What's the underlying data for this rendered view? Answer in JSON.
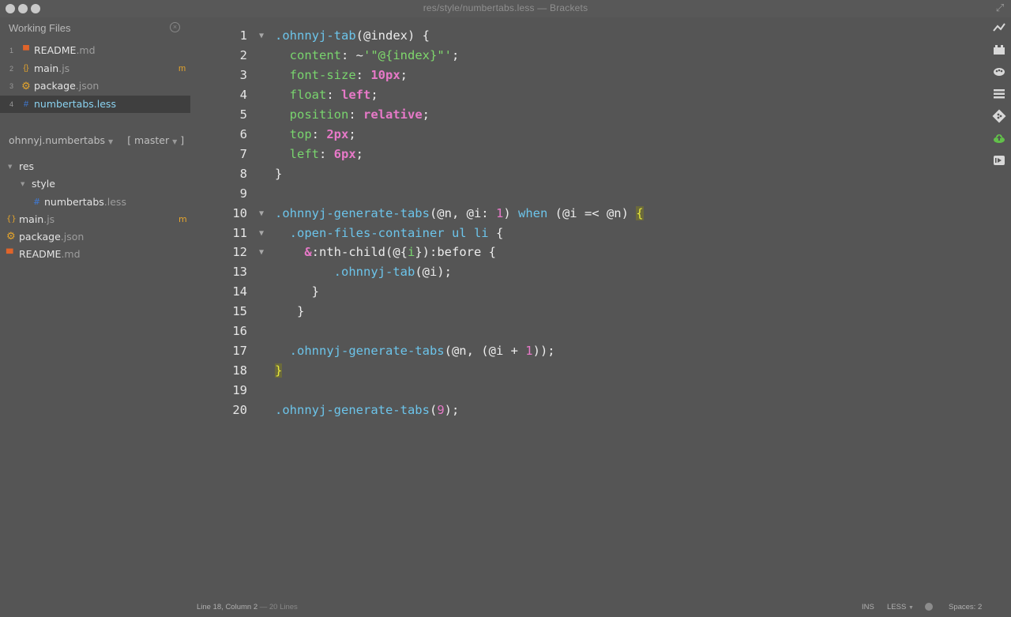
{
  "window": {
    "title": "res/style/numbertabs.less  —  Brackets"
  },
  "working_files": {
    "header": "Working Files",
    "items": [
      {
        "num": "1",
        "icon": "markdown-icon",
        "icon_glyph": "▀",
        "icon_color": "#e0642a",
        "name": "README",
        "ext": ".md",
        "badge": ""
      },
      {
        "num": "2",
        "icon": "js-braces-icon",
        "icon_glyph": "{}",
        "icon_color": "#e5a52c",
        "name": "main",
        "ext": ".js",
        "badge": "m"
      },
      {
        "num": "3",
        "icon": "gear-icon",
        "icon_glyph": "⚙",
        "icon_color": "#e5a52c",
        "name": "package",
        "ext": ".json",
        "badge": ""
      },
      {
        "num": "4",
        "icon": "hash-icon",
        "icon_glyph": "#",
        "icon_color": "#3f7ad6",
        "name": "numbertabs",
        "ext": ".less",
        "badge": ""
      }
    ]
  },
  "project": {
    "name": "ohnnyj.numbertabs",
    "branch": "[ master",
    "branch_close": "]"
  },
  "tree": {
    "res": "res",
    "style": "style",
    "numbertabs": {
      "name": "numbertabs",
      "ext": ".less"
    },
    "mainjs": {
      "name": "main",
      "ext": ".js",
      "badge": "m"
    },
    "package": {
      "name": "package",
      "ext": ".json"
    },
    "readme": {
      "name": "README",
      "ext": ".md"
    }
  },
  "code_lines": [
    {
      "n": "1",
      "fold": "▼",
      "parts": [
        [
          "sel",
          ".ohnnyj-tab"
        ],
        [
          "def",
          "(@index) {"
        ]
      ]
    },
    {
      "n": "2",
      "fold": "",
      "parts": [
        [
          "def",
          "  "
        ],
        [
          "prop",
          "content"
        ],
        [
          "def",
          ": ~"
        ],
        [
          "str",
          "'\"@{index}\"'"
        ],
        [
          "def",
          ";"
        ]
      ]
    },
    {
      "n": "3",
      "fold": "",
      "parts": [
        [
          "def",
          "  "
        ],
        [
          "prop",
          "font-size"
        ],
        [
          "def",
          ": "
        ],
        [
          "kw",
          "10px"
        ],
        [
          "def",
          ";"
        ]
      ]
    },
    {
      "n": "4",
      "fold": "",
      "parts": [
        [
          "def",
          "  "
        ],
        [
          "prop",
          "float"
        ],
        [
          "def",
          ": "
        ],
        [
          "kw",
          "left"
        ],
        [
          "def",
          ";"
        ]
      ]
    },
    {
      "n": "5",
      "fold": "",
      "parts": [
        [
          "def",
          "  "
        ],
        [
          "prop",
          "position"
        ],
        [
          "def",
          ": "
        ],
        [
          "kw",
          "relative"
        ],
        [
          "def",
          ";"
        ]
      ]
    },
    {
      "n": "6",
      "fold": "",
      "parts": [
        [
          "def",
          "  "
        ],
        [
          "prop",
          "top"
        ],
        [
          "def",
          ": "
        ],
        [
          "kw",
          "2px"
        ],
        [
          "def",
          ";"
        ]
      ]
    },
    {
      "n": "7",
      "fold": "",
      "parts": [
        [
          "def",
          "  "
        ],
        [
          "prop",
          "left"
        ],
        [
          "def",
          ": "
        ],
        [
          "kw",
          "6px"
        ],
        [
          "def",
          ";"
        ]
      ]
    },
    {
      "n": "8",
      "fold": "",
      "parts": [
        [
          "def",
          "}"
        ]
      ]
    },
    {
      "n": "9",
      "fold": "",
      "parts": []
    },
    {
      "n": "10",
      "fold": "▼",
      "parts": [
        [
          "sel",
          ".ohnnyj-generate-tabs"
        ],
        [
          "def",
          "(@n, @i: "
        ],
        [
          "num",
          "1"
        ],
        [
          "def",
          ") "
        ],
        [
          "when",
          "when"
        ],
        [
          "def",
          " (@i =< @n) "
        ],
        [
          "hl",
          "{"
        ]
      ]
    },
    {
      "n": "11",
      "fold": "▼",
      "parts": [
        [
          "def",
          "  "
        ],
        [
          "sel",
          ".open-files-container ul li"
        ],
        [
          "def",
          " {"
        ]
      ]
    },
    {
      "n": "12",
      "fold": "▼",
      "parts": [
        [
          "def",
          "    "
        ],
        [
          "amp",
          "&"
        ],
        [
          "def",
          ":nth-child(@{"
        ],
        [
          "prop",
          "i"
        ],
        [
          "def",
          "}):before {"
        ]
      ]
    },
    {
      "n": "13",
      "fold": "",
      "parts": [
        [
          "def",
          "        "
        ],
        [
          "sel",
          ".ohnnyj-tab"
        ],
        [
          "def",
          "(@i);"
        ]
      ]
    },
    {
      "n": "14",
      "fold": "",
      "parts": [
        [
          "def",
          "     }"
        ]
      ]
    },
    {
      "n": "15",
      "fold": "",
      "parts": [
        [
          "def",
          "   }"
        ]
      ]
    },
    {
      "n": "16",
      "fold": "",
      "parts": []
    },
    {
      "n": "17",
      "fold": "",
      "parts": [
        [
          "def",
          "  "
        ],
        [
          "sel",
          ".ohnnyj-generate-tabs"
        ],
        [
          "def",
          "(@n, (@i + "
        ],
        [
          "num",
          "1"
        ],
        [
          "def",
          "));"
        ]
      ]
    },
    {
      "n": "18",
      "fold": "",
      "parts": [
        [
          "hl",
          "}"
        ]
      ]
    },
    {
      "n": "19",
      "fold": "",
      "parts": []
    },
    {
      "n": "20",
      "fold": "",
      "parts": [
        [
          "sel",
          ".ohnnyj-generate-tabs"
        ],
        [
          "def",
          "("
        ],
        [
          "num",
          "9"
        ],
        [
          "def",
          ");"
        ]
      ]
    }
  ],
  "toolbar_icons": [
    "live-preview-icon",
    "extension-manager-icon",
    "theme-icon",
    "outline-list-icon",
    "git-icon",
    "cloud-upload-icon",
    "exit-icon"
  ],
  "statusbar": {
    "position": "Line 18, Column 2",
    "lines": "— 20 Lines",
    "mode": "INS",
    "language": "LESS",
    "spaces": "Spaces:  2"
  }
}
